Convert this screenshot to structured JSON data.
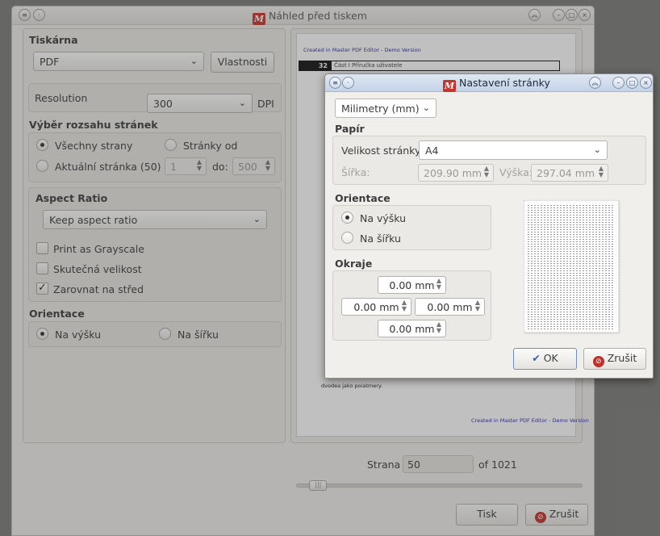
{
  "main": {
    "title": "Náhled před tiskem",
    "logo_letter": "M",
    "printer": {
      "section_title": "Tiskárna",
      "selected": "PDF",
      "properties_button": "Vlastnosti",
      "resolution_label": "Resolution",
      "resolution_value": "300",
      "resolution_unit": "DPI"
    },
    "range": {
      "section_title": "Výběr rozsahu stránek",
      "all_pages": "Všechny strany",
      "pages_from": "Stránky od",
      "current_page": "Aktuální stránka (50)",
      "from_value": "1",
      "to_label": "do:",
      "to_value": "500"
    },
    "aspect": {
      "section_title": "Aspect Ratio",
      "selected": "Keep aspect ratio",
      "grayscale": "Print as Grayscale",
      "real_size": "Skutečná velikost",
      "center": "Zarovnat na střed"
    },
    "orientation": {
      "section_title": "Orientace",
      "portrait": "Na výšku",
      "landscape": "Na šířku"
    },
    "preview": {
      "watermark_top": "Created in Master PDF Editor - Demo Version",
      "page_badge": "32",
      "chapter_text": "Část I  Příručka uživatele",
      "body_text": "dvodea jako poiatmery.",
      "watermark_bottom": "Created in Master PDF Editor - Demo Version"
    },
    "pager": {
      "label": "Strana",
      "value": "50",
      "of_text": "of 1021",
      "slider_fraction": 0.049
    },
    "buttons": {
      "print": "Tisk",
      "cancel": "Zrušit"
    }
  },
  "dialog": {
    "title": "Nastavení stránky",
    "units_selected": "Milimetry (mm)",
    "paper": {
      "section_title": "Papír",
      "size_label": "Velikost stránky:",
      "size_value": "A4",
      "width_label": "Šířka:",
      "width_value": "209.90 mm",
      "height_label": "Výška:",
      "height_value": "297.04 mm"
    },
    "orientation": {
      "section_title": "Orientace",
      "portrait": "Na výšku",
      "landscape": "Na šířku"
    },
    "margins": {
      "section_title": "Okraje",
      "top": "0.00 mm",
      "left": "0.00 mm",
      "right": "0.00 mm",
      "bottom": "0.00 mm"
    },
    "buttons": {
      "ok": "OK",
      "cancel": "Zrušit"
    }
  },
  "colors": {
    "accent_check": "#3465a4",
    "cancel_icon": "#c0302a",
    "logo": "#c8342c"
  }
}
